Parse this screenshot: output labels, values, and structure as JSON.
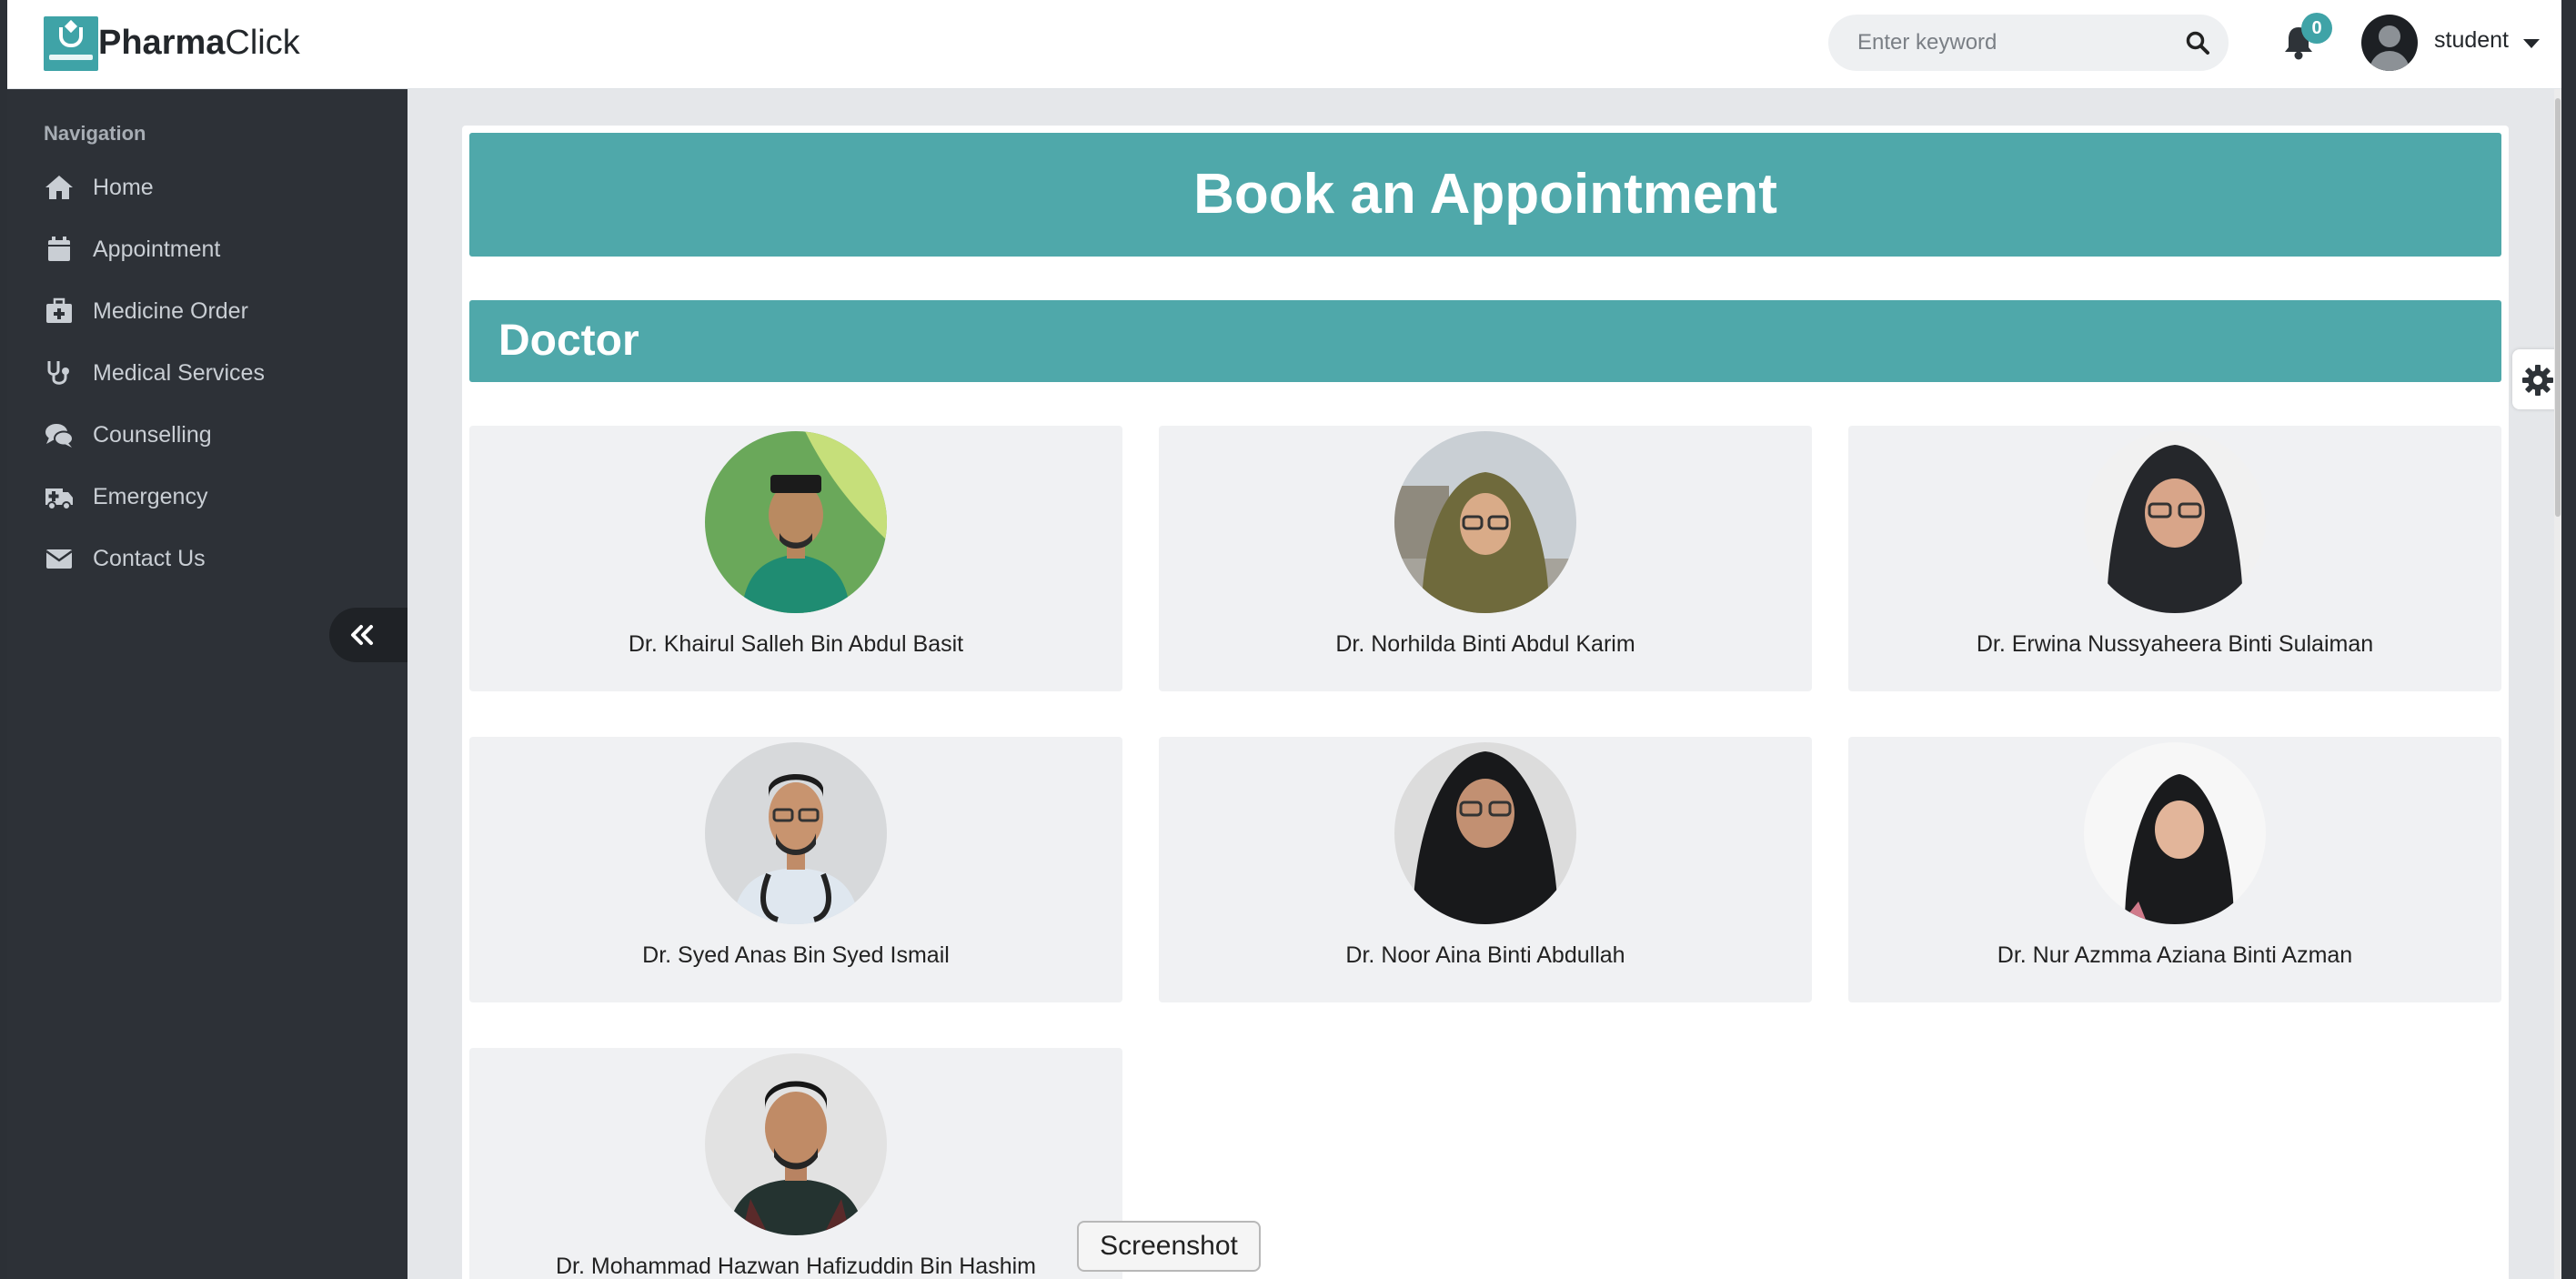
{
  "brand": {
    "bold": "Pharma",
    "rest": "Click"
  },
  "search": {
    "placeholder": "Enter keyword"
  },
  "notifications": {
    "count": "0"
  },
  "user": {
    "name": "student"
  },
  "sidebar": {
    "heading": "Navigation",
    "items": [
      {
        "label": "Home",
        "icon": "home-icon"
      },
      {
        "label": "Appointment",
        "icon": "calendar-icon"
      },
      {
        "label": "Medicine Order",
        "icon": "medical-kit-icon"
      },
      {
        "label": "Medical Services",
        "icon": "stethoscope-icon"
      },
      {
        "label": "Counselling",
        "icon": "chat-icon"
      },
      {
        "label": "Emergency",
        "icon": "ambulance-icon"
      },
      {
        "label": "Contact Us",
        "icon": "envelope-icon"
      }
    ]
  },
  "main": {
    "title": "Book an Appointment",
    "section": "Doctor",
    "doctors": [
      {
        "name": "Dr. Khairul Salleh Bin Abdul Basit"
      },
      {
        "name": "Dr. Norhilda Binti Abdul Karim"
      },
      {
        "name": "Dr. Erwina Nussyaheera Binti Sulaiman"
      },
      {
        "name": "Dr. Syed Anas Bin Syed Ismail"
      },
      {
        "name": "Dr. Noor Aina Binti Abdullah"
      },
      {
        "name": "Dr. Nur Azmma Aziana Binti Azman"
      },
      {
        "name": "Dr. Mohammad Hazwan Hafizuddin Bin Hashim"
      }
    ]
  },
  "overlay": {
    "screenshot_label": "Screenshot"
  },
  "colors": {
    "accent": "#4fa8aa",
    "sidebar": "#2d3137",
    "badge": "#3fa3a7"
  }
}
